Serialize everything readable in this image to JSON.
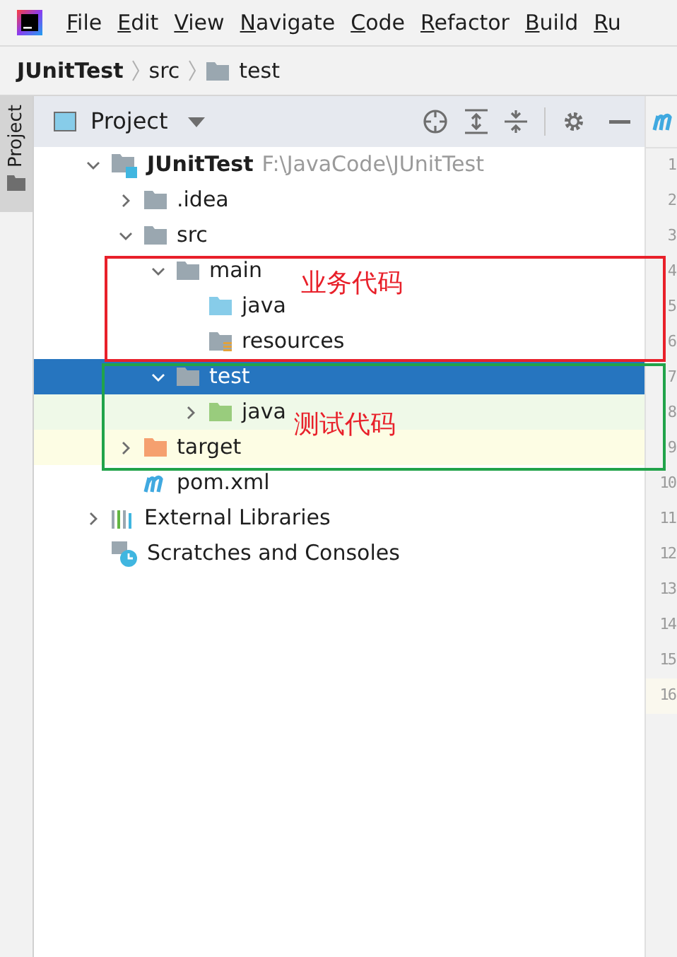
{
  "menu": [
    "File",
    "Edit",
    "View",
    "Navigate",
    "Code",
    "Refactor",
    "Build",
    "Ru"
  ],
  "breadcrumb": [
    {
      "label": "JUnitTest",
      "kind": "project"
    },
    {
      "label": "src",
      "kind": "plain"
    },
    {
      "label": "test",
      "kind": "folder"
    }
  ],
  "side_tab": {
    "label": "Project"
  },
  "panel": {
    "title": "Project"
  },
  "tree": [
    {
      "kind": "module",
      "label": "JUnitTest",
      "path": "F:\\JavaCode\\JUnitTest",
      "expanded": true,
      "selected": false,
      "children": [
        {
          "kind": "folder",
          "label": ".idea",
          "expanded": false,
          "selected": false
        },
        {
          "kind": "folder",
          "label": "src",
          "expanded": true,
          "selected": false,
          "children": [
            {
              "kind": "folder",
              "label": "main",
              "expanded": true,
              "selected": false,
              "children": [
                {
                  "kind": "source",
                  "label": "java",
                  "selected": false
                },
                {
                  "kind": "resources",
                  "label": "resources",
                  "selected": false
                }
              ]
            },
            {
              "kind": "folder",
              "label": "test",
              "expanded": true,
              "selected": true,
              "children": [
                {
                  "kind": "test",
                  "label": "java",
                  "expanded": false,
                  "selected": false
                }
              ]
            }
          ]
        },
        {
          "kind": "excluded",
          "label": "target",
          "expanded": false,
          "selected": false
        },
        {
          "kind": "maven",
          "label": "pom.xml",
          "selected": false
        }
      ]
    },
    {
      "kind": "libraries",
      "label": "External Libraries",
      "expanded": false,
      "selected": false
    },
    {
      "kind": "scratches",
      "label": "Scratches and Consoles",
      "selected": false
    }
  ],
  "annotations": [
    {
      "label": "业务代码",
      "color": "#e8202a"
    },
    {
      "label": "测试代码",
      "color": "#21a34a"
    }
  ],
  "line_numbers": [
    "1",
    "2",
    "3",
    "4",
    "5",
    "6",
    "7",
    "8",
    "9",
    "10",
    "11",
    "12",
    "13",
    "14",
    "15",
    "16"
  ]
}
